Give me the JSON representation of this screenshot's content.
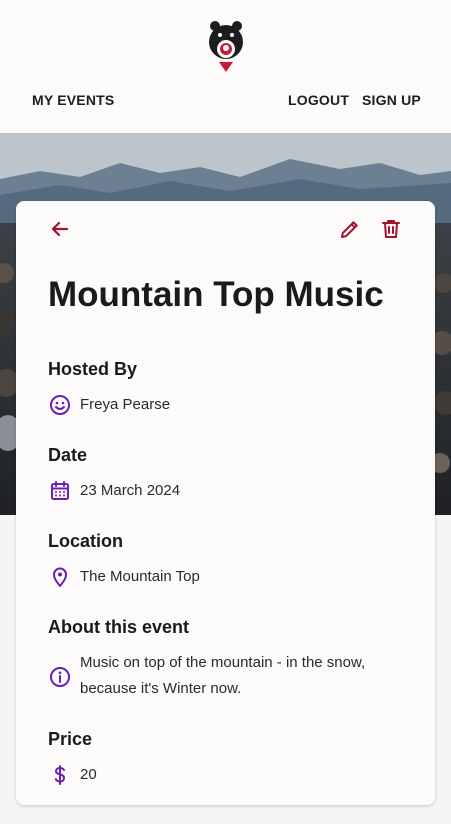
{
  "nav": {
    "my_events": "MY EVENTS",
    "logout": "LOGOUT",
    "sign_up": "SIGN UP"
  },
  "event": {
    "title": "Mountain Top Music",
    "hosted_by_label": "Hosted By",
    "host": "Freya Pearse",
    "date_label": "Date",
    "date": "23 March 2024",
    "location_label": "Location",
    "location": "The Mountain Top",
    "about_label": "About this event",
    "about_line1": "Music on top of the mountain - in the snow,",
    "about_line2": "because it's Winter now.",
    "price_label": "Price",
    "price": "20"
  },
  "colors": {
    "accent": "#a3122a",
    "icon": "#6b1fb3",
    "page_bg": "#f4f4f5",
    "card_bg": "#fdfafa"
  },
  "icons": {
    "back": "arrow-left-icon",
    "edit": "pencil-icon",
    "delete": "trash-icon",
    "host": "smiley-face-icon",
    "date": "calendar-icon",
    "location": "map-pin-icon",
    "about": "info-icon",
    "price": "dollar-icon"
  }
}
